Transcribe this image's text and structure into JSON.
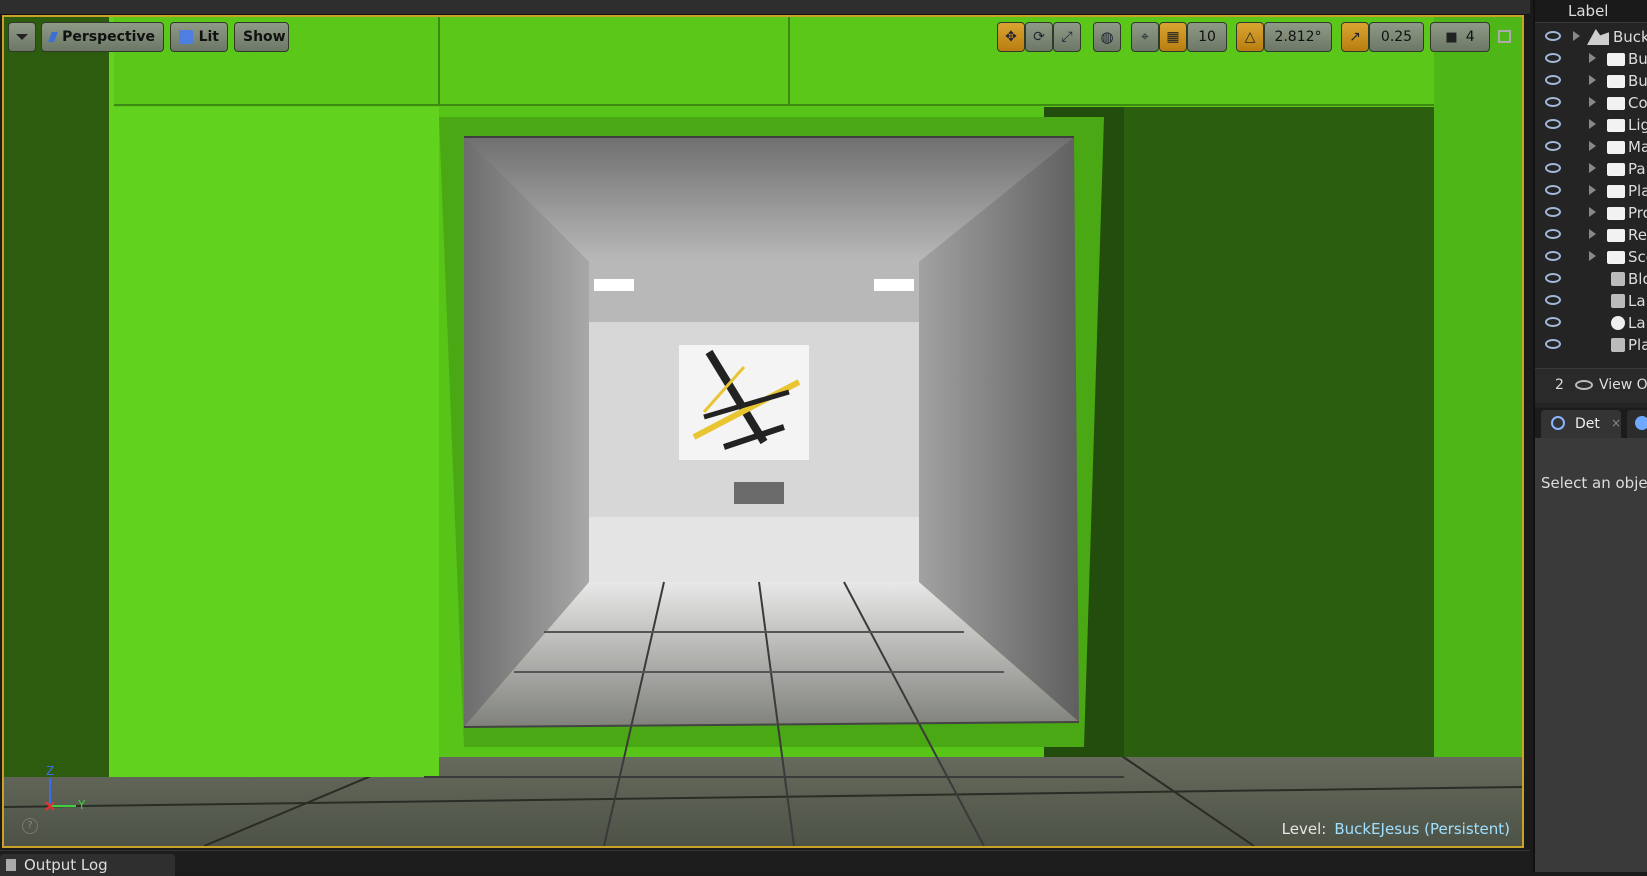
{
  "viewport": {
    "view_mode": "Perspective",
    "lighting": "Lit",
    "show": "Show",
    "grid_snap": "10",
    "rotation_snap": "2.812°",
    "scale_snap": "0.25",
    "camera_speed": "4",
    "level_prefix": "Level:",
    "level_name": "BuckEJesus (Persistent)",
    "axis_z": "Z",
    "axis_y": "Y"
  },
  "outliner": {
    "column_label": "Label",
    "rows": [
      {
        "label": "Buck",
        "icon": "world-icon"
      },
      {
        "label": "Bu",
        "icon": "folder-icon"
      },
      {
        "label": "Bu",
        "icon": "folder-icon"
      },
      {
        "label": "Co",
        "icon": "folder-icon"
      },
      {
        "label": "Lig",
        "icon": "folder-icon"
      },
      {
        "label": "Ma",
        "icon": "folder-icon"
      },
      {
        "label": "Pa",
        "icon": "folder-icon"
      },
      {
        "label": "Pla",
        "icon": "folder-icon"
      },
      {
        "label": "Pro",
        "icon": "folder-icon"
      },
      {
        "label": "Re",
        "icon": "folder-icon"
      },
      {
        "label": "Sce",
        "icon": "folder-icon"
      },
      {
        "label": "Blo",
        "icon": "volume-icon"
      },
      {
        "label": "La",
        "icon": "landscape-icon"
      },
      {
        "label": "La",
        "icon": "sphere-icon"
      },
      {
        "label": "Pla",
        "icon": "player-start-icon"
      }
    ],
    "actor_count": "2",
    "view_options": "View Op"
  },
  "details": {
    "tab_label": "Det",
    "message": "Select an object"
  },
  "bottom": {
    "output_log": "Output Log"
  }
}
